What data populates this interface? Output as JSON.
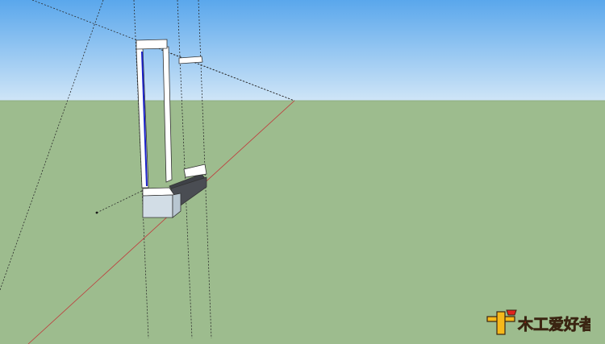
{
  "colors": {
    "sky_top": "#5aa7ec",
    "sky_bottom": "#cfe5f7",
    "ground": "#9dbc8e",
    "horizon": "#8fae82",
    "model_white": "#ffffff",
    "model_blue_edge": "#1a22c8",
    "model_dark": "#3e4147",
    "model_light_face": "#d2dde6",
    "axis_red": "#c0393b",
    "guide_line": "#2b2b2b"
  },
  "watermark": {
    "text": "木工爱好者",
    "icon": "woodworker-logo-icon",
    "accent_colors": [
      "#f6b81b",
      "#e0241e",
      "#3a2512"
    ]
  }
}
